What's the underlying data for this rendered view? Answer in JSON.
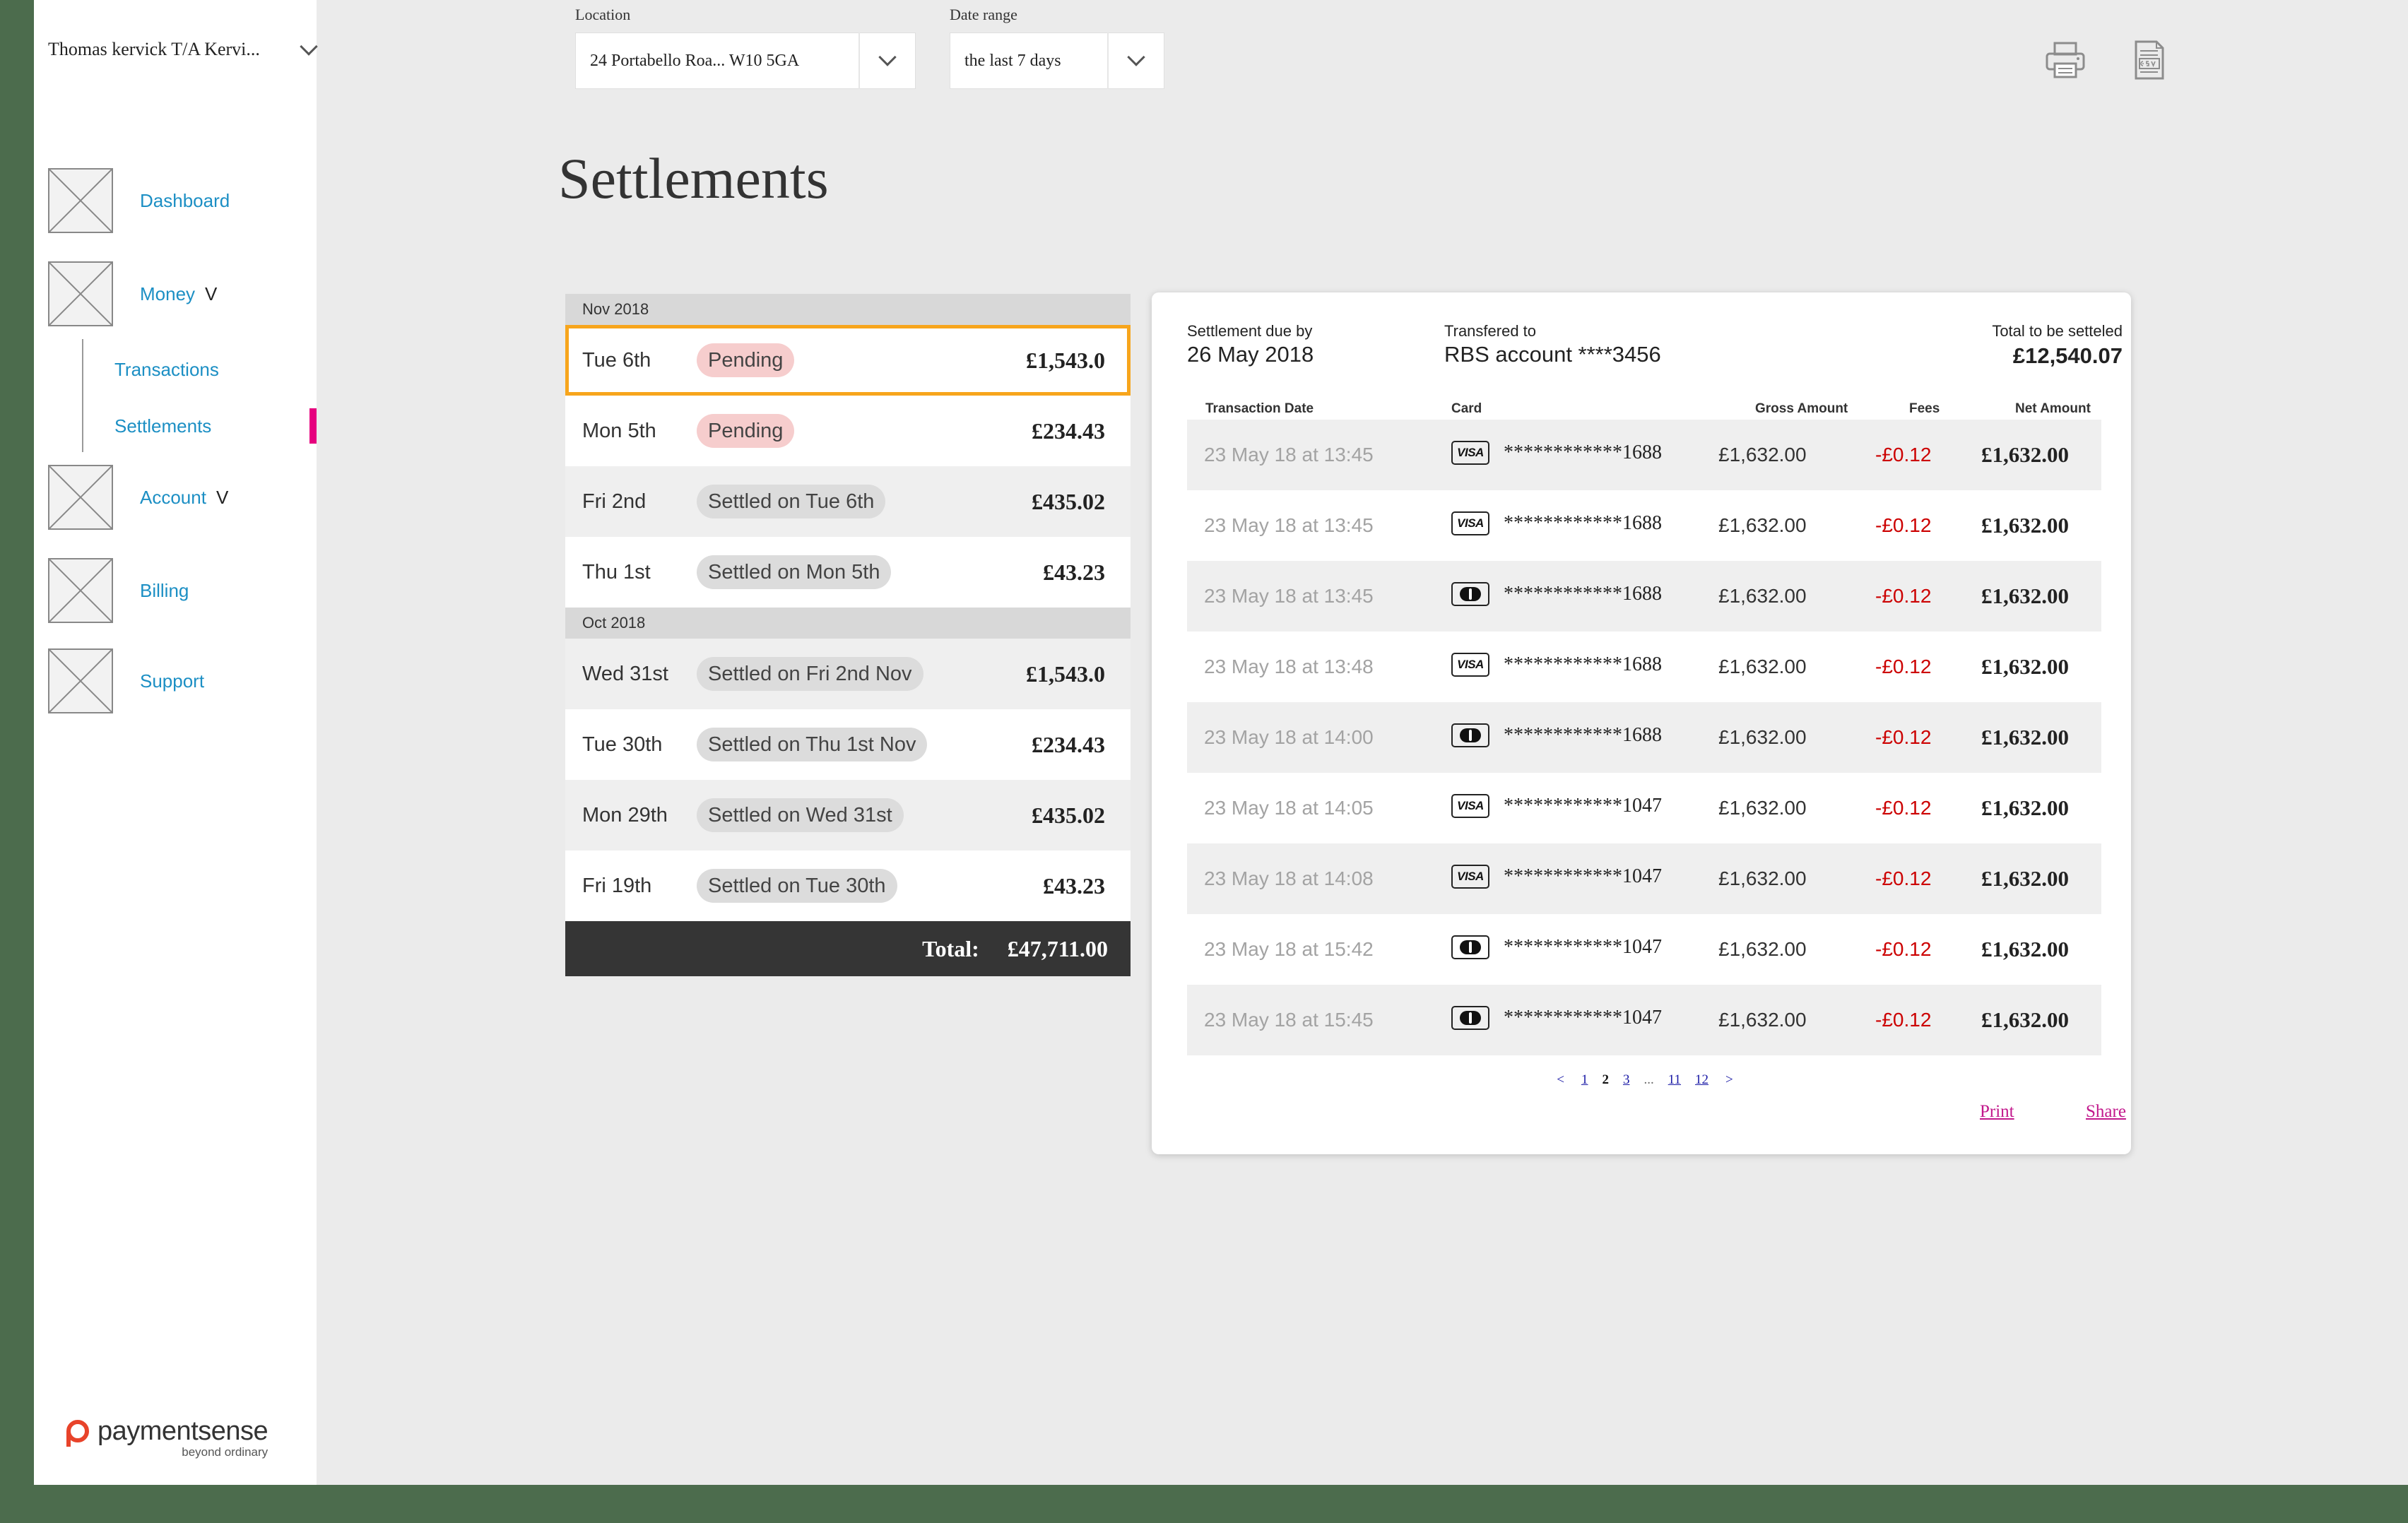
{
  "account": {
    "name": "Thomas kervick T/A Kervi..."
  },
  "nav": {
    "dashboard": "Dashboard",
    "money": "Money",
    "money_caret": "V",
    "transactions": "Transactions",
    "settlements": "Settlements",
    "account": "Account",
    "account_caret": "V",
    "billing": "Billing",
    "support": "Support"
  },
  "brand": {
    "name": "paymentsense",
    "tagline": "beyond ordinary"
  },
  "filters": {
    "location_label": "Location",
    "location_value": "24 Portabello Roa... W10 5GA",
    "date_label": "Date range",
    "date_value": "the last 7 days"
  },
  "toolbar": {
    "print_icon": "printer-icon",
    "csv_icon": "csv-icon"
  },
  "page": {
    "title": "Settlements"
  },
  "settlements": {
    "months": [
      {
        "label": "Nov 2018",
        "rows": [
          {
            "day": "Tue 6th",
            "status": "Pending",
            "kind": "pending",
            "amount": "£1,543.0",
            "selected": true
          },
          {
            "day": "Mon 5th",
            "status": "Pending",
            "kind": "pending",
            "amount": "£234.43"
          },
          {
            "day": "Fri 2nd",
            "status": "Settled on Tue 6th",
            "kind": "settled",
            "amount": "£435.02"
          },
          {
            "day": "Thu 1st",
            "status": "Settled on Mon 5th",
            "kind": "settled",
            "amount": "£43.23"
          }
        ]
      },
      {
        "label": "Oct 2018",
        "rows": [
          {
            "day": "Wed 31st",
            "status": "Settled on Fri 2nd Nov",
            "kind": "settled",
            "amount": "£1,543.0"
          },
          {
            "day": "Tue 30th",
            "status": "Settled on Thu 1st Nov",
            "kind": "settled",
            "amount": "£234.43"
          },
          {
            "day": "Mon 29th",
            "status": "Settled on Wed 31st",
            "kind": "settled",
            "amount": "£435.02"
          },
          {
            "day": "Fri 19th",
            "status": "Settled on Tue 30th",
            "kind": "settled",
            "amount": "£43.23"
          }
        ]
      }
    ],
    "total_label": "Total:",
    "total_value": "£47,711.00"
  },
  "detail": {
    "due_label": "Settlement due by",
    "due_value": "26 May 2018",
    "transfer_label": "Transfered to",
    "transfer_value": "RBS account ****3456",
    "total_label": "Total to be setteled",
    "total_value": "£12,540.07",
    "columns": {
      "date": "Transaction Date",
      "card": "Card",
      "gross": "Gross Amount",
      "fees": "Fees",
      "net": "Net Amount"
    },
    "transactions": [
      {
        "date": "23 May 18 at 13:45",
        "card_type": "visa",
        "card_label": "VISA",
        "pan": "************1688",
        "gross": "£1,632.00",
        "fee": "-£0.12",
        "net": "£1,632.00"
      },
      {
        "date": "23 May 18 at 13:45",
        "card_type": "visa",
        "card_label": "VISA",
        "pan": "************1688",
        "gross": "£1,632.00",
        "fee": "-£0.12",
        "net": "£1,632.00"
      },
      {
        "date": "23 May 18 at 13:45",
        "card_type": "mastercard",
        "card_label": "",
        "pan": "************1688",
        "gross": "£1,632.00",
        "fee": "-£0.12",
        "net": "£1,632.00"
      },
      {
        "date": "23 May 18 at 13:48",
        "card_type": "visa",
        "card_label": "VISA",
        "pan": "************1688",
        "gross": "£1,632.00",
        "fee": "-£0.12",
        "net": "£1,632.00"
      },
      {
        "date": "23 May 18 at 14:00",
        "card_type": "mastercard",
        "card_label": "",
        "pan": "************1688",
        "gross": "£1,632.00",
        "fee": "-£0.12",
        "net": "£1,632.00"
      },
      {
        "date": "23 May 18 at 14:05",
        "card_type": "visa",
        "card_label": "VISA",
        "pan": "************1047",
        "gross": "£1,632.00",
        "fee": "-£0.12",
        "net": "£1,632.00"
      },
      {
        "date": "23 May 18 at 14:08",
        "card_type": "visa",
        "card_label": "VISA",
        "pan": "************1047",
        "gross": "£1,632.00",
        "fee": "-£0.12",
        "net": "£1,632.00"
      },
      {
        "date": "23 May 18 at 15:42",
        "card_type": "mastercard",
        "card_label": "",
        "pan": "************1047",
        "gross": "£1,632.00",
        "fee": "-£0.12",
        "net": "£1,632.00"
      },
      {
        "date": "23 May 18 at 15:45",
        "card_type": "mastercard",
        "card_label": "",
        "pan": "************1047",
        "gross": "£1,632.00",
        "fee": "-£0.12",
        "net": "£1,632.00"
      }
    ],
    "pagination": {
      "prev": "<",
      "pages": [
        "1",
        "2",
        "3",
        "...",
        "11",
        "12"
      ],
      "current": "2",
      "next": ">"
    },
    "print_label": "Print",
    "share_label": "Share"
  },
  "colors": {
    "accent_link": "#1c8fc4",
    "active_marker": "#e6007e",
    "selected_border": "#f7a51c",
    "pending_pill": "#f6cdcd",
    "fee_red": "#cc0000",
    "action_link": "#c2188c"
  }
}
